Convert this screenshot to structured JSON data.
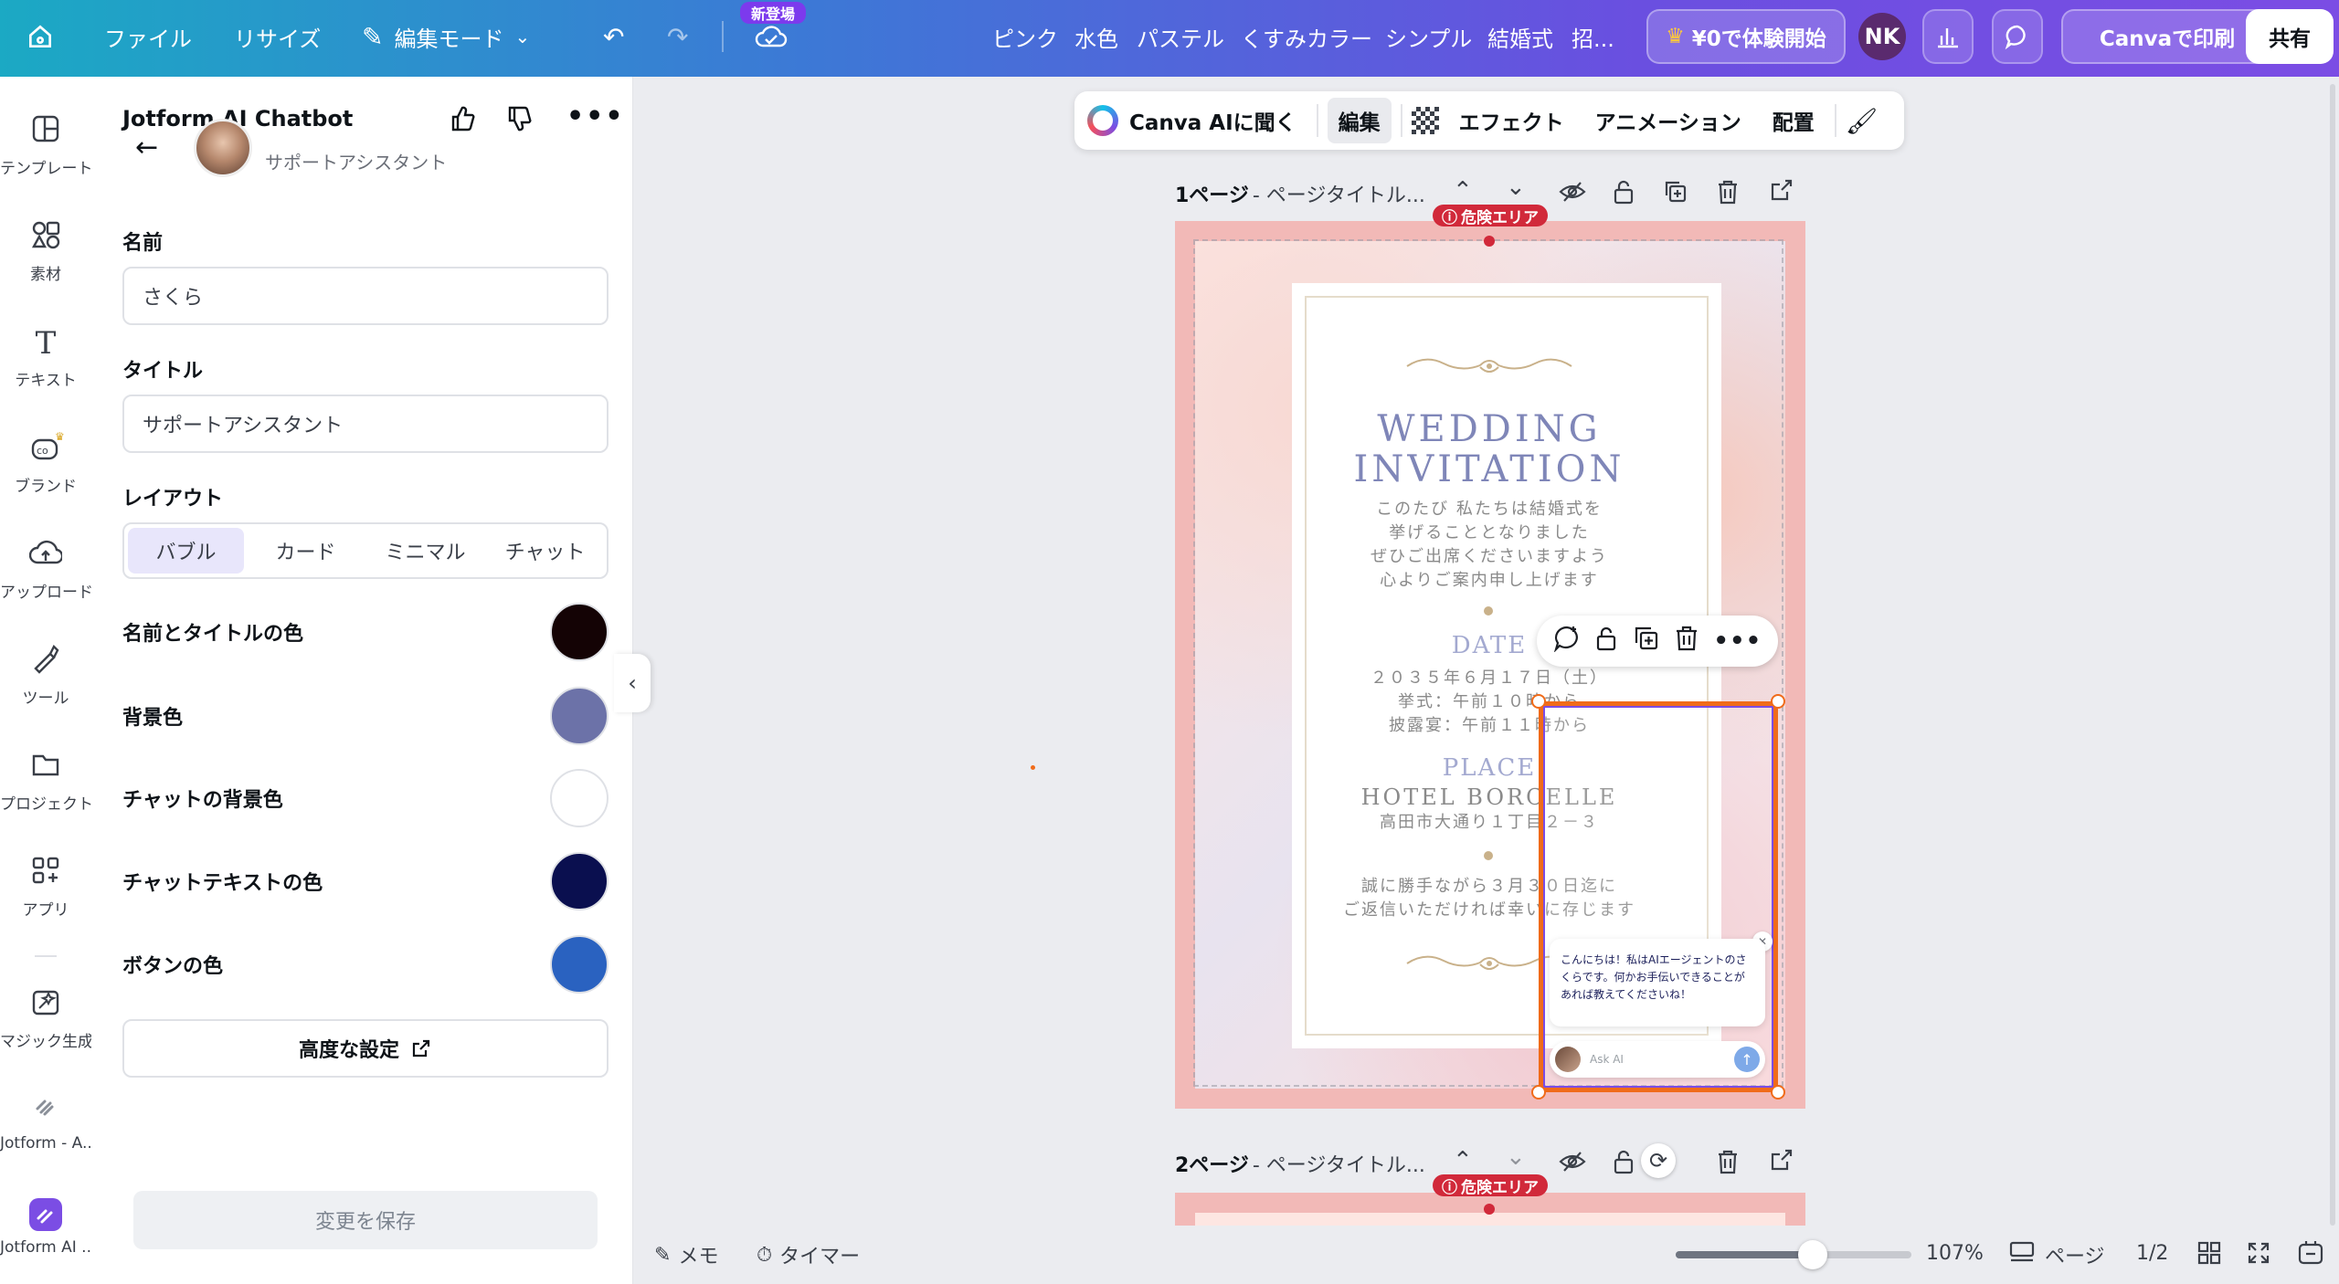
{
  "topbar": {
    "file": "ファイル",
    "resize": "リサイズ",
    "edit_mode": "編集モード",
    "new_badge": "新登場",
    "keywords": [
      "ピンク",
      "水色",
      "パステル",
      "くすみカラー",
      "シンプル",
      "結婚式",
      "招..."
    ],
    "trial": "¥0で体験開始",
    "avatar_initials": "NK",
    "print": "Canvaで印刷",
    "share": "共有"
  },
  "rail": {
    "items": [
      {
        "icon": "template-icon",
        "label": "テンプレート"
      },
      {
        "icon": "elements-icon",
        "label": "素材"
      },
      {
        "icon": "text-icon",
        "label": "テキスト"
      },
      {
        "icon": "brand-icon",
        "label": "ブランド"
      },
      {
        "icon": "upload-icon",
        "label": "アップロード"
      },
      {
        "icon": "tools-icon",
        "label": "ツール"
      },
      {
        "icon": "project-icon",
        "label": "プロジェクト"
      },
      {
        "icon": "apps-icon",
        "label": "アプリ"
      },
      {
        "icon": "magic-icon",
        "label": "マジック生成"
      },
      {
        "icon": "jotform-icon",
        "label": "Jotform - A..."
      },
      {
        "icon": "jotform-ai-icon",
        "label": "Jotform AI ..."
      }
    ]
  },
  "panel": {
    "title": "Jotform AI Chatbot",
    "agent_subtitle": "サポートアシスタント",
    "name_label": "名前",
    "name_value": "さくら",
    "title_label": "タイトル",
    "title_value": "サポートアシスタント",
    "layout_label": "レイアウト",
    "layout_options": [
      "バブル",
      "カード",
      "ミニマル",
      "チャット"
    ],
    "layout_selected": "バブル",
    "colors": [
      {
        "label": "名前とタイトルの色",
        "value": "#140305"
      },
      {
        "label": "背景色",
        "value": "#6c72a8"
      },
      {
        "label": "チャットの背景色",
        "value": "#ffffff"
      },
      {
        "label": "チャットテキストの色",
        "value": "#0a0f4f"
      },
      {
        "label": "ボタンの色",
        "value": "#2a62c0"
      }
    ],
    "advanced": "高度な設定",
    "save": "変更を保存"
  },
  "editbar": {
    "ask_ai": "Canva AIに聞く",
    "edit": "編集",
    "effects": "エフェクト",
    "animation": "アニメーション",
    "arrange": "配置"
  },
  "page1": {
    "label": "1ページ",
    "title_placeholder": "- ページタイトル...",
    "danger": "危険エリア"
  },
  "page2": {
    "label": "2ページ",
    "title_placeholder": "- ページタイトル...",
    "danger": "危険エリア"
  },
  "invitation": {
    "title_line1": "WEDDING",
    "title_line2": "INVITATION",
    "intro": [
      "このたび 私たちは結婚式を",
      "挙げることとなりました",
      "ぜひご出席くださいますよう",
      "心よりご案内申し上げます"
    ],
    "date_head": "DATE",
    "date_lines": [
      "２０３５年６月１７日（土）",
      "挙式：午前１０時から",
      "披露宴：午前１１時から"
    ],
    "place_head": "PLACE",
    "place_name": "HOTEL BORCELLE",
    "place_address": "高田市大通り１丁目２－３",
    "rsvp": [
      "誠に勝手ながら３月３０日迄に",
      "ご返信いただければ幸いに存じます"
    ]
  },
  "chatbot": {
    "message": "こんにちは！私はAIエージェントのさくらです。何かお手伝いできることがあれば教えてくださいね！",
    "input_placeholder": "Ask AI"
  },
  "bottombar": {
    "notes": "メモ",
    "timer": "タイマー",
    "zoom": "107%",
    "zoom_level": 0.58,
    "pages": "ページ",
    "page_count": "1/2"
  }
}
